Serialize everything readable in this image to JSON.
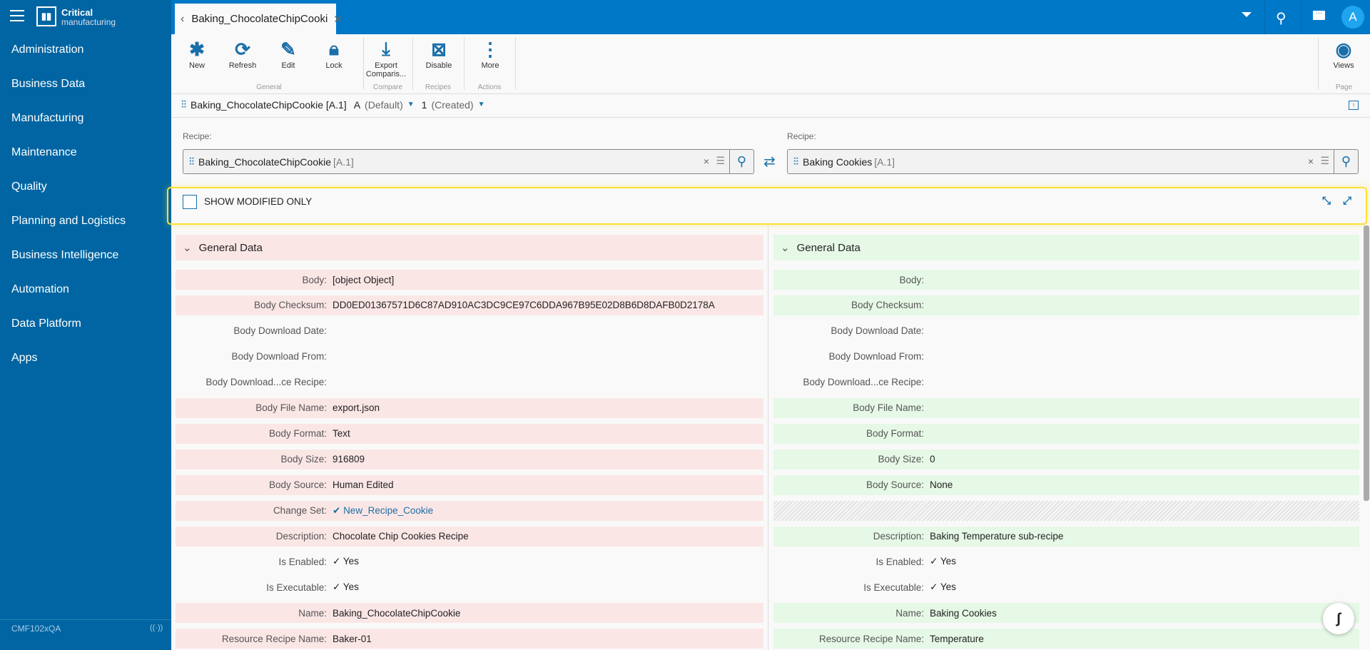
{
  "app": {
    "brand_line1": "Critical",
    "brand_line2": "manufacturing",
    "avatar": "A",
    "footer_instance": "CMF102xQA"
  },
  "sidebar": {
    "items": [
      {
        "label": "Administration"
      },
      {
        "label": "Business Data"
      },
      {
        "label": "Manufacturing"
      },
      {
        "label": "Maintenance"
      },
      {
        "label": "Quality"
      },
      {
        "label": "Planning and Logistics"
      },
      {
        "label": "Business Intelligence"
      },
      {
        "label": "Automation"
      },
      {
        "label": "Data Platform"
      },
      {
        "label": "Apps"
      }
    ]
  },
  "tab": {
    "title": "Baking_ChocolateChipCooki"
  },
  "toolbar": {
    "buttons": [
      {
        "label": "New",
        "icon": "asterisk-icon"
      },
      {
        "label": "Refresh",
        "icon": "refresh-icon"
      },
      {
        "label": "Edit",
        "icon": "pencil-icon"
      },
      {
        "label": "Lock",
        "icon": "lock-icon"
      },
      {
        "label": "Export Comparis...",
        "icon": "export-icon"
      },
      {
        "label": "Disable",
        "icon": "disable-icon"
      },
      {
        "label": "More",
        "icon": "more-icon"
      },
      {
        "label": "Views",
        "icon": "eye-icon"
      }
    ],
    "groups": [
      "General",
      "Compare",
      "Recipes",
      "Actions",
      "Page"
    ]
  },
  "entity": {
    "name": "Baking_ChocolateChipCookie [A.1]",
    "version": "A",
    "version_state": "(Default)",
    "revision": "1",
    "revision_state": "(Created)"
  },
  "compare": {
    "left_label": "Recipe:",
    "left_value": "Baking_ChocolateChipCookie",
    "left_version": "[A.1]",
    "right_label": "Recipe:",
    "right_value": "Baking Cookies",
    "right_version": "[A.1]",
    "show_modified_label": "SHOW MODIFIED ONLY",
    "show_modified_checked": false
  },
  "section_title": "General Data",
  "rows": [
    {
      "label": "Body:",
      "left": "[object Object]",
      "right": "",
      "diff": true
    },
    {
      "label": "Body Checksum:",
      "left": "DD0ED01367571D6C87AD910AC3DC9CE97C6DDA967B95E02D8B6D8DAFB0D2178A",
      "right": "",
      "diff": true
    },
    {
      "label": "Body Download Date:",
      "left": "",
      "right": "",
      "diff": false
    },
    {
      "label": "Body Download From:",
      "left": "",
      "right": "",
      "diff": false
    },
    {
      "label": "Body Download...ce Recipe:",
      "left": "",
      "right": "",
      "diff": false
    },
    {
      "label": "Body File Name:",
      "left": "export.json",
      "right": "",
      "diff": true
    },
    {
      "label": "Body Format:",
      "left": "Text",
      "right": "",
      "diff": true
    },
    {
      "label": "Body Size:",
      "left": "916809",
      "right": "0",
      "diff": true
    },
    {
      "label": "Body Source:",
      "left": "Human Edited",
      "right": "None",
      "diff": true
    },
    {
      "label": "Change Set:",
      "left": "New_Recipe_Cookie",
      "right": null,
      "diff": true,
      "link": true
    },
    {
      "label": "Description:",
      "left": "Chocolate Chip Cookies Recipe",
      "right": "Baking Temperature sub-recipe",
      "diff": true
    },
    {
      "label": "Is Enabled:",
      "left": "✓ Yes",
      "right": "✓ Yes",
      "diff": false
    },
    {
      "label": "Is Executable:",
      "left": "✓ Yes",
      "right": "✓ Yes",
      "diff": false
    },
    {
      "label": "Name:",
      "left": "Baking_ChocolateChipCookie",
      "right": "Baking Cookies",
      "diff": true
    },
    {
      "label": "Resource Recipe Name:",
      "left": "Baker-01",
      "right": "Temperature",
      "diff": true
    }
  ],
  "colors": {
    "topbar": "#0078c8",
    "sidebar": "#0065a2",
    "removed": "#fbe6e6",
    "added": "#e6f8e6",
    "highlight": "#ffe033"
  }
}
